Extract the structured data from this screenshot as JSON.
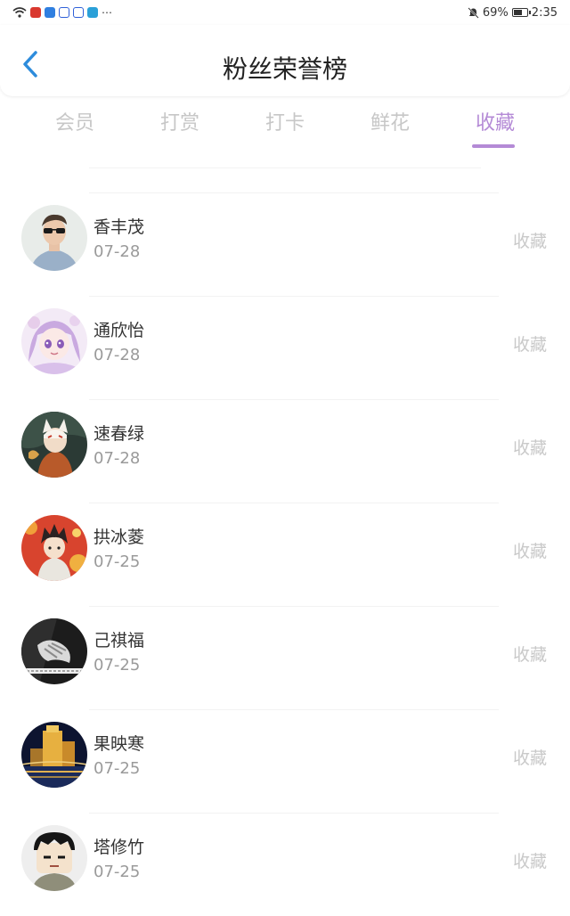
{
  "status_bar": {
    "battery": "69%",
    "battery_level": 0.69,
    "time": "2:35",
    "left_icons": [
      "wifi-icon",
      "news-app-icon",
      "cloud-app-icon",
      "baidu-app-icon",
      "baidu-app-icon",
      "tablet-app-icon",
      "more-dots-icon"
    ],
    "right_icons": [
      "mute-bell-icon",
      "battery-icon"
    ]
  },
  "header": {
    "title": "粉丝荣誉榜",
    "back_icon": "chevron-left-icon"
  },
  "tabs": [
    {
      "label": "会员"
    },
    {
      "label": "打赏"
    },
    {
      "label": "打卡"
    },
    {
      "label": "鲜花"
    },
    {
      "label": "收藏"
    }
  ],
  "active_tab": 4,
  "colors": {
    "accent": "#b48ad6",
    "back": "#2d8cdc",
    "inactive_tab": "#c7c7c7",
    "action": "#c9c9c9"
  },
  "fans": [
    {
      "name": "香丰茂",
      "date": "07-28",
      "action": "收藏",
      "avatar": "man-with-sunglasses"
    },
    {
      "name": "通欣怡",
      "date": "07-28",
      "action": "收藏",
      "avatar": "anime-girl-purple"
    },
    {
      "name": "速春绿",
      "date": "07-28",
      "action": "收藏",
      "avatar": "anime-fox-mask"
    },
    {
      "name": "拱冰菱",
      "date": "07-25",
      "action": "收藏",
      "avatar": "anime-boy-red"
    },
    {
      "name": "己祺福",
      "date": "07-25",
      "action": "收藏",
      "avatar": "bw-hands"
    },
    {
      "name": "果映寒",
      "date": "07-25",
      "action": "收藏",
      "avatar": "city-night"
    },
    {
      "name": "塔修竹",
      "date": "07-25",
      "action": "收藏",
      "avatar": "cartoon-face"
    }
  ]
}
